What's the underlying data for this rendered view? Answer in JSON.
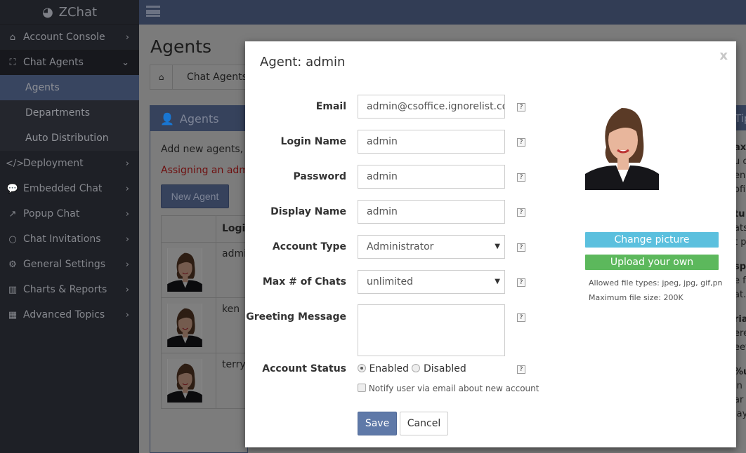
{
  "app": {
    "name": "ZChat"
  },
  "sidebar": {
    "items": [
      {
        "label": "Account Console",
        "icon": "home-icon"
      },
      {
        "label": "Chat Agents",
        "icon": "sitemap-icon",
        "open": true,
        "children": [
          {
            "label": "Agents",
            "active": true
          },
          {
            "label": "Departments"
          },
          {
            "label": "Auto Distribution"
          }
        ]
      },
      {
        "label": "Deployment",
        "icon": "code-icon"
      },
      {
        "label": "Embedded Chat",
        "icon": "comments-icon"
      },
      {
        "label": "Popup Chat",
        "icon": "external-link-icon"
      },
      {
        "label": "Chat Invitations",
        "icon": "comment-icon"
      },
      {
        "label": "General Settings",
        "icon": "cogs-icon"
      },
      {
        "label": "Charts & Reports",
        "icon": "bar-chart-icon"
      },
      {
        "label": "Advanced Topics",
        "icon": "table-icon"
      }
    ]
  },
  "page": {
    "title": "Agents",
    "breadcrumb": [
      "Chat Agents"
    ],
    "panel": {
      "title": "Agents",
      "description": "Add new agents, d",
      "warning": "Assigning an admi",
      "new_button": "New Agent",
      "table": {
        "headers": [
          "",
          "Login"
        ],
        "rows": [
          {
            "login": "admi"
          },
          {
            "login": "ken"
          },
          {
            "login": "terry"
          }
        ]
      }
    },
    "tips": {
      "title": "Tip",
      "fragments": [
        [
          "ax",
          "u c",
          "en",
          "ofi"
        ],
        [
          "tu",
          "ats",
          "t p"
        ],
        [
          "spl",
          "e f",
          "at."
        ],
        [
          "ria",
          "ere",
          "eet"
        ],
        [
          "%u",
          "in",
          "ar",
          "lay"
        ]
      ]
    }
  },
  "modal": {
    "title": "Agent: admin",
    "close": "x",
    "fields": {
      "email": {
        "label": "Email",
        "value": "admin@csoffice.ignorelist.com"
      },
      "login": {
        "label": "Login Name",
        "value": "admin"
      },
      "password": {
        "label": "Password",
        "value": "admin"
      },
      "display": {
        "label": "Display Name",
        "value": "admin"
      },
      "account_type": {
        "label": "Account Type",
        "value": "Administrator"
      },
      "max_chats": {
        "label": "Max # of Chats",
        "value": "unlimited"
      },
      "greeting": {
        "label": "Greeting Message",
        "value": ""
      },
      "status": {
        "label": "Account Status",
        "enabled": "Enabled",
        "disabled": "Disabled",
        "selected": "Enabled"
      },
      "notify": {
        "label": "Notify user via email about new account",
        "checked": false
      }
    },
    "help": "?",
    "save": "Save",
    "cancel": "Cancel",
    "picture": {
      "change": "Change picture",
      "upload": "Upload your own",
      "allowed": "Allowed file types: jpeg, jpg, gif,png",
      "max_size": "Maximum file size: 200K"
    },
    "colors": {
      "primary": "#5f79a8",
      "info": "#5bc0de",
      "success": "#5cb85c"
    }
  }
}
